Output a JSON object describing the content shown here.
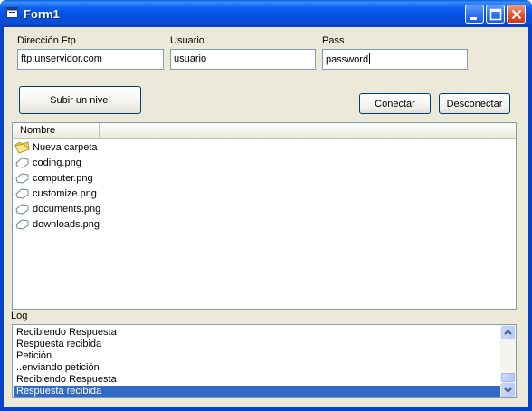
{
  "window": {
    "title": "Form1"
  },
  "form": {
    "ftp_label": "Dirección Ftp",
    "ftp_value": "ftp.unservidor.com",
    "user_label": "Usuario",
    "user_value": "usuario",
    "pass_label": "Pass",
    "pass_value": "password"
  },
  "buttons": {
    "up_level": "Subir un nivel",
    "connect": "Conectar",
    "disconnect": "Desconectar"
  },
  "files": {
    "column_header": "Nombre",
    "items": [
      {
        "name": "Nueva carpeta",
        "icon": "folder-icon"
      },
      {
        "name": "coding.png",
        "icon": "file-icon"
      },
      {
        "name": "computer.png",
        "icon": "file-icon"
      },
      {
        "name": "customize.png",
        "icon": "file-icon"
      },
      {
        "name": "documents.png",
        "icon": "file-icon"
      },
      {
        "name": "downloads.png",
        "icon": "file-icon"
      }
    ]
  },
  "log": {
    "label": "Log",
    "lines": [
      "Recibiendo Respuesta",
      "Respuesta recibida",
      "Petición",
      "..enviando petición",
      "Recibiendo Respuesta",
      "Respuesta recibida"
    ],
    "selected_index": 5
  },
  "colors": {
    "titlebar": "#0a5ef0",
    "client_bg": "#ece9d8",
    "selection": "#316ac5",
    "close_button": "#e2512c"
  }
}
